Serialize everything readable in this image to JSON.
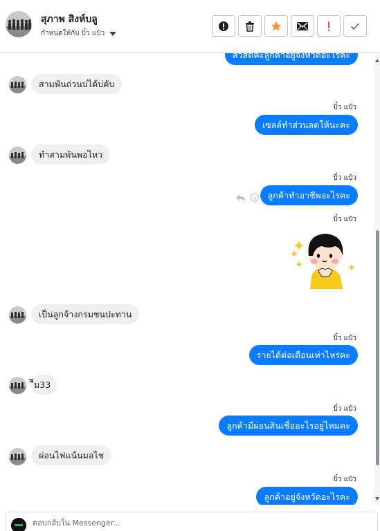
{
  "header": {
    "contact_name": "สุภาพ สิงห์บลู",
    "assigned_to": "กำหนดให้กับ บิ๋ว แป๋ว",
    "toolbar": [
      {
        "icon": "alert-circle-icon",
        "label": "Mark as spam"
      },
      {
        "icon": "trash-icon",
        "label": "Delete"
      },
      {
        "icon": "star-icon",
        "label": "Star"
      },
      {
        "icon": "mail-icon",
        "label": "Mark as unread"
      },
      {
        "icon": "exclamation-icon",
        "label": "Flag"
      },
      {
        "icon": "check-icon",
        "label": "Mark as done"
      }
    ]
  },
  "colors": {
    "outgoing_bubble": "#0a7cff",
    "incoming_bubble": "#f1f0f0",
    "star": "#f7923b",
    "flag": "#e4493a"
  },
  "messages": [
    {
      "direction": "out",
      "sender": "",
      "text": "สวัสดีค่ะลูกค้าอยู่จังหวัดอะไรคะ",
      "partial": true
    },
    {
      "direction": "in",
      "text": "สามพันถ่วนบ่ได้บ่คับ"
    },
    {
      "direction": "out",
      "sender": "บิ๋ว แป๋ว",
      "text": "เซลล์ทำส่วนลดให้นะคะ"
    },
    {
      "direction": "in",
      "text": "ทำสามพันพอไหว"
    },
    {
      "direction": "out",
      "sender": "บิ๋ว แป๋ว",
      "text": "ลูกค้าทำอาชีพอะไรคะ"
    },
    {
      "direction": "out",
      "sender": "บิ๋ว แป๋ว",
      "type": "sticker",
      "text": ""
    },
    {
      "direction": "in",
      "text": "เป็นลูกจ้างกรมชนปะทาน"
    },
    {
      "direction": "out",
      "sender": "บิ๋ว แป๋ว",
      "text": "รายได้ต่อเดือนเท่าไหร่คะ"
    },
    {
      "direction": "in",
      "text": "ืีม33"
    },
    {
      "direction": "out",
      "sender": "บิ๋ว แป๋ว",
      "text": "ลูกค้ามีผ่อนสินเชื่ออะไรอยู่ไหมคะ"
    },
    {
      "direction": "in",
      "text": "ผ่อนไฟแน้นมอไช"
    },
    {
      "direction": "out",
      "sender": "บิ๋ว แป๋ว",
      "text": "ลูกค้าอยู่จังหวัดอะไรคะ"
    }
  ],
  "composer": {
    "placeholder": "ตอบกลับใน Messenger..."
  }
}
